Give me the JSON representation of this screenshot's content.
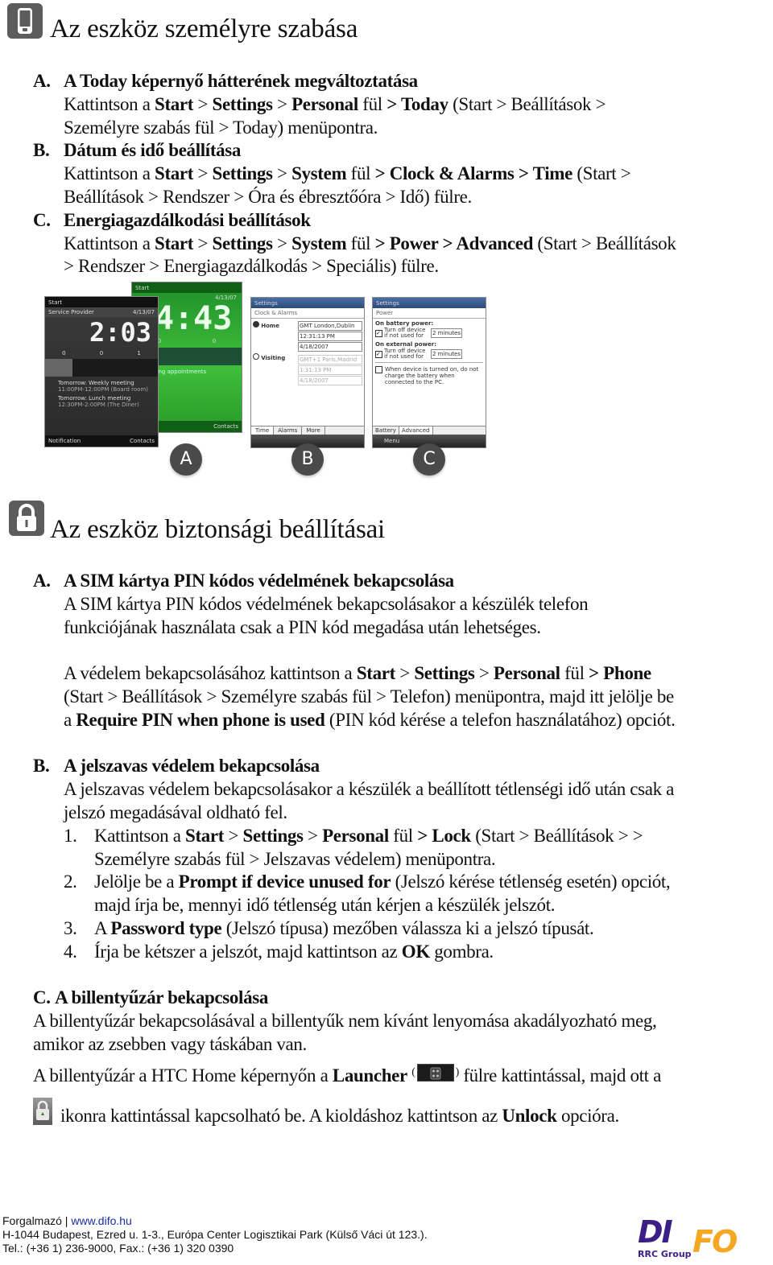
{
  "section1": {
    "title": "Az eszköz személyre szabása",
    "icon": "pda-phone-icon",
    "items": [
      {
        "letter": "A.",
        "heading": "A Today képernyő hátterének megváltoztatása",
        "lines": [
          [
            {
              "t": "Kattintson a "
            },
            {
              "t": "Start",
              "b": true
            },
            {
              "t": " > "
            },
            {
              "t": "Settings",
              "b": true
            },
            {
              "t": " > "
            },
            {
              "t": "Personal",
              "b": true
            },
            {
              "t": " fül "
            },
            {
              "t": "> Today",
              "b": true
            },
            {
              "t": " (Start > Beállítások >"
            }
          ],
          [
            {
              "t": "Személyre szabás fül > Today) menüpontra."
            }
          ]
        ]
      },
      {
        "letter": "B.",
        "heading": "Dátum és idő beállítása",
        "lines": [
          [
            {
              "t": "Kattintson a "
            },
            {
              "t": "Start",
              "b": true
            },
            {
              "t": " > "
            },
            {
              "t": "Settings",
              "b": true
            },
            {
              "t": " > "
            },
            {
              "t": "System",
              "b": true
            },
            {
              "t": " fül "
            },
            {
              "t": "> Clock & Alarms > Time",
              "b": true
            },
            {
              "t": " (Start >"
            }
          ],
          [
            {
              "t": "Beállítások > Rendszer > Óra és ébresztőóra > Idő) fülre."
            }
          ]
        ]
      },
      {
        "letter": "C.",
        "heading": "Energiagazdálkodási beállítások",
        "lines": [
          [
            {
              "t": "Kattintson a "
            },
            {
              "t": "Start",
              "b": true
            },
            {
              "t": " > "
            },
            {
              "t": "Settings",
              "b": true
            },
            {
              "t": " > "
            },
            {
              "t": "System",
              "b": true
            },
            {
              "t": " fül "
            },
            {
              "t": "> Power > Advanced",
              "b": true
            },
            {
              "t": " (Start > Beállítások"
            }
          ],
          [
            {
              "t": "> Rendszer > Energiagazdálkodás > Speciális) fülre."
            }
          ]
        ]
      }
    ],
    "screens": {
      "a_dark": {
        "start": "Start",
        "provider": "Service Provider",
        "date": "4/13/07",
        "time": "2:03",
        "counts": [
          "0",
          "0",
          "1"
        ],
        "appointments": [
          {
            "title": "Tomorrow: Weekly meeting",
            "detail": "11:00PM-12:00PM (Board room)"
          },
          {
            "title": "Tomorrow: Lunch meeting",
            "detail": "12:30PM-2:00PM (The Diner)"
          }
        ],
        "softkeys": [
          "Notification",
          "Contacts"
        ]
      },
      "a_green": {
        "start": "Start",
        "date": "4/13/07",
        "time": "4:43",
        "counts": [
          "0",
          "0"
        ],
        "appointments": "Upcoming appointments",
        "softkeys": [
          "",
          "Contacts"
        ]
      },
      "b": {
        "title": "Settings",
        "subtitle": "Clock & Alarms",
        "home_label": "Home",
        "visiting_label": "Visiting",
        "home_zone": "GMT London,Dublin",
        "home_time": "12:31:13 PM",
        "home_date": "4/18/2007",
        "visit_zone": "GMT+1 Paris,Madrid",
        "visit_time": "1:31:13 PM",
        "visit_date": "4/18/2007",
        "tabs": [
          "Time",
          "Alarms",
          "More"
        ]
      },
      "c": {
        "title": "Settings",
        "subtitle": "Power",
        "battery_label": "On battery power:",
        "battery_option": "Turn off device if not used for",
        "battery_value": "2 minutes",
        "external_label": "On external power:",
        "external_option": "Turn off device if not used for",
        "external_value": "2 minutes",
        "charge_option": "When device is turned on, do not charge the battery when connected to the PC.",
        "tabs": [
          "Battery",
          "Advanced"
        ],
        "softkey": "Menu"
      },
      "labels": [
        "A",
        "B",
        "C"
      ]
    }
  },
  "section2": {
    "title": "Az eszköz biztonsági beállításai",
    "icon": "padlock-icon",
    "a": {
      "letter": "A.",
      "heading": "A SIM kártya PIN kódos védelmének bekapcsolása",
      "lines": [
        [
          {
            "t": "A SIM kártya PIN kódos védelmének bekapcsolásakor a készülék telefon"
          }
        ],
        [
          {
            "t": "funkciójának használata csak a PIN kód megadása után lehetséges."
          }
        ]
      ],
      "lines2": [
        [
          {
            "t": "A védelem bekapcsolásához kattintson a "
          },
          {
            "t": "Start",
            "b": true
          },
          {
            "t": " > "
          },
          {
            "t": "Settings",
            "b": true
          },
          {
            "t": " > "
          },
          {
            "t": "Personal",
            "b": true
          },
          {
            "t": " fül "
          },
          {
            "t": "> Phone",
            "b": true
          }
        ],
        [
          {
            "t": "(Start > Beállítások > Személyre szabás fül > Telefon) menüpontra, majd itt jelölje be"
          }
        ],
        [
          {
            "t": "a "
          },
          {
            "t": "Require PIN when phone is used",
            "b": true
          },
          {
            "t": " (PIN kód kérése a telefon használatához) opciót."
          }
        ]
      ]
    },
    "b": {
      "letter": "B.",
      "heading": "A jelszavas védelem bekapcsolása",
      "lines": [
        [
          {
            "t": "A jelszavas védelem bekapcsolásakor a készülék a beállított tétlenségi idő után csak a"
          }
        ],
        [
          {
            "t": "jelszó megadásával oldható fel."
          }
        ]
      ],
      "steps": [
        {
          "num": "1.",
          "lines": [
            [
              {
                "t": "Kattintson a "
              },
              {
                "t": "Start",
                "b": true
              },
              {
                "t": " > "
              },
              {
                "t": "Settings",
                "b": true
              },
              {
                "t": " > "
              },
              {
                "t": "Personal",
                "b": true
              },
              {
                "t": " fül "
              },
              {
                "t": "> Lock",
                "b": true
              },
              {
                "t": " (Start > Beállítások > >"
              }
            ],
            [
              {
                "t": "Személyre szabás fül > Jelszavas védelem) menüpontra."
              }
            ]
          ]
        },
        {
          "num": "2.",
          "lines": [
            [
              {
                "t": "Jelölje be a "
              },
              {
                "t": "Prompt if device unused for",
                "b": true
              },
              {
                "t": " (Jelszó kérése tétlenség esetén) opciót,"
              }
            ],
            [
              {
                "t": "majd írja be, mennyi idő tétlenség után kérjen a készülék jelszót."
              }
            ]
          ]
        },
        {
          "num": "3.",
          "lines": [
            [
              {
                "t": "A "
              },
              {
                "t": "Password type",
                "b": true
              },
              {
                "t": " (Jelszó típusa) mezőben válassza ki a jelszó típusát."
              }
            ]
          ]
        },
        {
          "num": "4.",
          "lines": [
            [
              {
                "t": "Írja be kétszer a jelszót, majd kattintson az "
              },
              {
                "t": "OK",
                "b": true
              },
              {
                "t": " gombra."
              }
            ]
          ]
        }
      ]
    },
    "c": {
      "letter": "C.",
      "heading": "A billentyűzár bekapcsolása",
      "lines": [
        [
          {
            "t": "A billentyűzár bekapcsolásával a billentyűk nem kívánt lenyomása akadályozható meg,"
          }
        ],
        [
          {
            "t": "amikor az zsebben vagy táskában van."
          }
        ]
      ],
      "launcher_pre": [
        {
          "t": "A billentyűzár a HTC Home képernyőn a "
        },
        {
          "t": "Launcher",
          "b": true
        },
        {
          "t": " "
        }
      ],
      "launcher_post": [
        {
          "t": "fülre kattintással, majd ott a"
        }
      ],
      "lock_line": [
        {
          "t": "ikonra kattintással kapcsolható be. A kioldáshoz kattintson az "
        },
        {
          "t": "Unlock",
          "b": true
        },
        {
          "t": " opcióra."
        }
      ]
    }
  },
  "footer": {
    "distributor_label": "Forgalmazó | ",
    "website": "www.difo.hu",
    "address": "H-1044 Budapest, Ezred u. 1-3., Európa Center Logisztikai Park (Külső Váci út 123.).",
    "phone": "Tel.: (+36 1) 236-9000, Fax.: (+36 1) 320 0390",
    "logo_text_main": "DI",
    "logo_text_accent": "FO",
    "logo_sub": "RRC Group",
    "colors": {
      "link": "#1a2fa0",
      "logo_purple": "#3b1f86",
      "logo_orange": "#f5a623"
    }
  }
}
